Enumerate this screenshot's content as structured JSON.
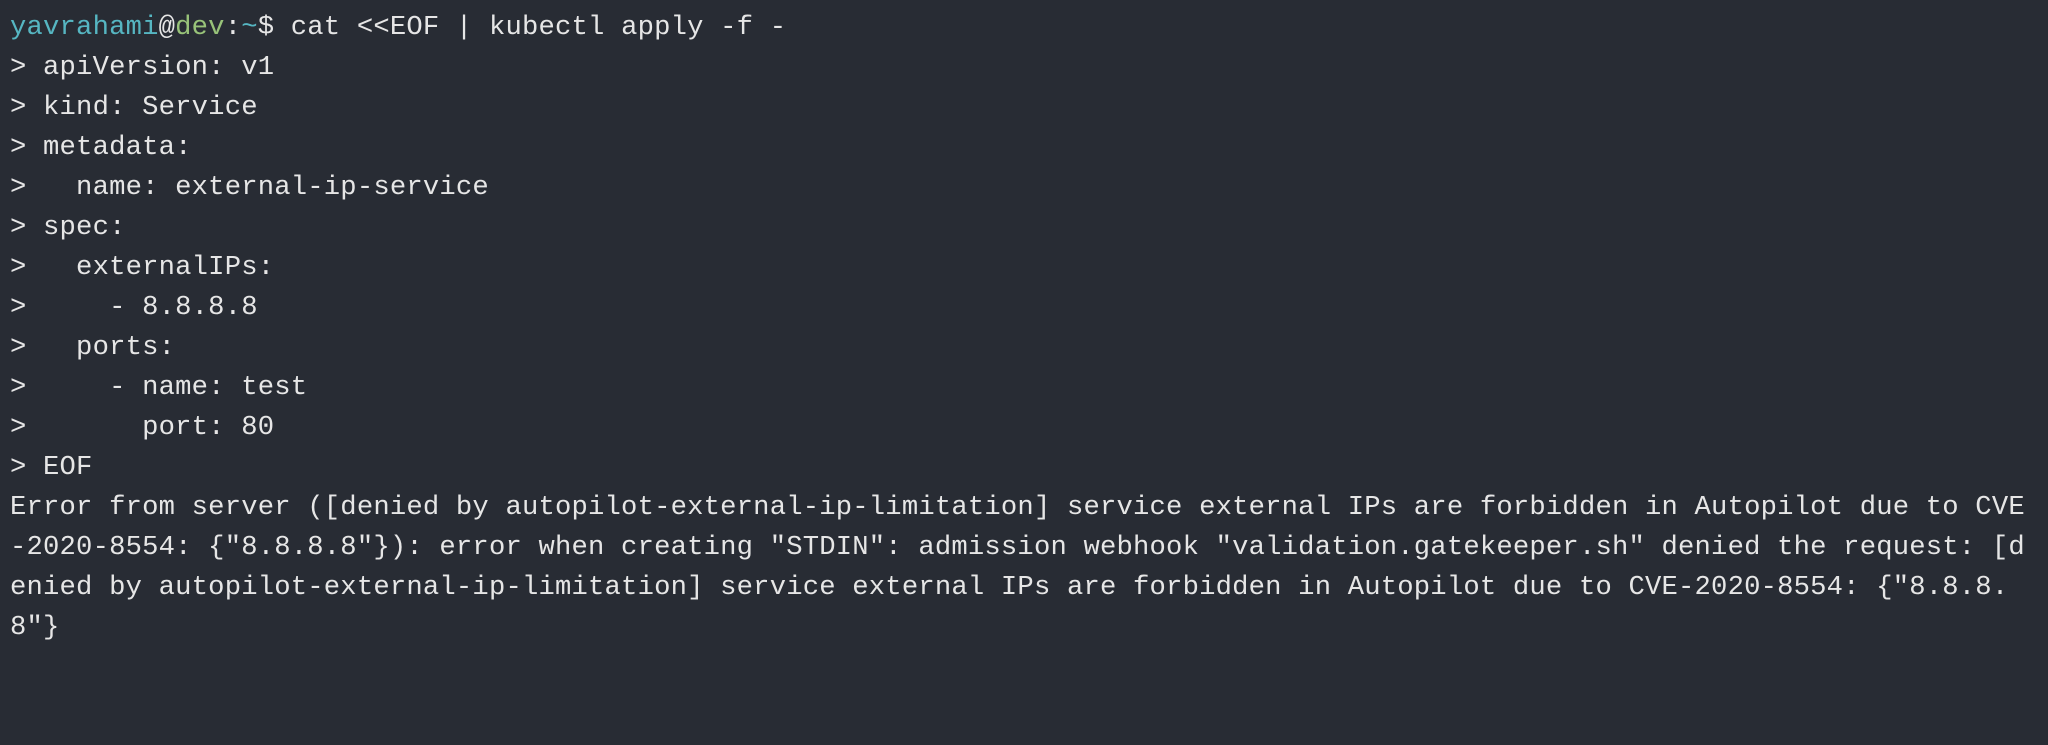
{
  "prompt": {
    "user": "yavrahami",
    "at": "@",
    "host": "dev",
    "sep": ":",
    "path": "~",
    "dollar": "$ "
  },
  "command": "cat <<EOF | kubectl apply -f -",
  "heredoc": [
    "> apiVersion: v1",
    "> kind: Service",
    "> metadata:",
    ">   name: external-ip-service",
    "> spec:",
    ">   externalIPs:",
    ">     - 8.8.8.8",
    ">   ports:",
    ">     - name: test",
    ">       port: 80",
    "> EOF"
  ],
  "error": "Error from server ([denied by autopilot-external-ip-limitation] service external IPs are forbidden in Autopilot due to CVE-2020-8554: {\"8.8.8.8\"}): error when creating \"STDIN\": admission webhook \"validation.gatekeeper.sh\" denied the request: [denied by autopilot-external-ip-limitation] service external IPs are forbidden in Autopilot due to CVE-2020-8554: {\"8.8.8.8\"}"
}
